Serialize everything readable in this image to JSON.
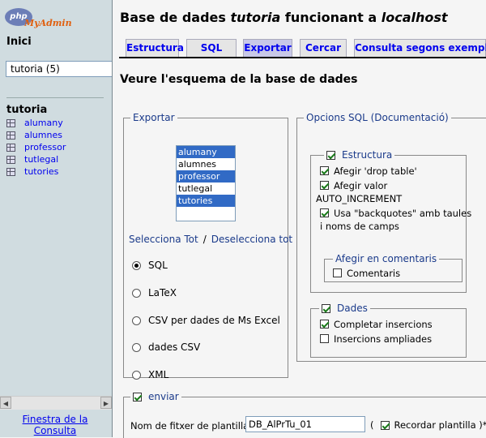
{
  "logo": {
    "php": "php",
    "name": "MyAdmin"
  },
  "sidebar": {
    "home": "Inici",
    "db_select": "tutoria (5)",
    "db_title": "tutoria",
    "tables": [
      "alumany",
      "alumnes",
      "professor",
      "tutlegal",
      "tutories"
    ],
    "query_window": "Finestra de la Consulta"
  },
  "header": {
    "prefix": "Base de dades ",
    "db": "tutoria",
    "middle": " funcionant a ",
    "host": "localhost"
  },
  "tabs": [
    {
      "label": "Estructura",
      "active": false
    },
    {
      "label": "SQL",
      "active": false
    },
    {
      "label": "Exportar",
      "active": true
    },
    {
      "label": "Cercar",
      "active": false
    },
    {
      "label": "Consulta segons exemple",
      "active": false
    }
  ],
  "subtitle": "Veure l'esquema de la base de dades",
  "export": {
    "legend": "Exportar",
    "tables": [
      {
        "name": "alumany",
        "selected": true
      },
      {
        "name": "alumnes",
        "selected": false
      },
      {
        "name": "professor",
        "selected": true
      },
      {
        "name": "tutlegal",
        "selected": false
      },
      {
        "name": "tutories",
        "selected": true
      }
    ],
    "select_all": "Selecciona Tot",
    "separator": "/",
    "deselect_all": "Deselecciona tot",
    "formats": [
      {
        "label": "SQL",
        "checked": true
      },
      {
        "label": "LaTeX",
        "checked": false
      },
      {
        "label": "CSV per dades de Ms Excel",
        "checked": false
      },
      {
        "label": "dades CSV",
        "checked": false
      },
      {
        "label": "XML",
        "checked": false
      }
    ]
  },
  "sql_options": {
    "legend": "Opcions SQL (Documentació)",
    "structure": {
      "legend": "Estructura",
      "checked": true,
      "drop_table": "Afegir 'drop table'",
      "auto_increment_1": "Afegir valor",
      "auto_increment_2": "AUTO_INCREMENT",
      "backquotes_1": "Usa \"backquotes\" amb taules",
      "backquotes_2": "i noms de camps",
      "comments_legend": "Afegir en comentaris",
      "comments": "Comentaris"
    },
    "data": {
      "legend": "Dades",
      "checked": true,
      "complete_inserts": "Completar insercions",
      "extended_inserts": "Insercions ampliades"
    }
  },
  "send": {
    "legend": "enviar",
    "template_label": "Nom de fitxer de plantilla :",
    "template_value": "DB_AlPrTu_01",
    "remember_open": "(",
    "remember": "Recordar plantilla )*"
  }
}
